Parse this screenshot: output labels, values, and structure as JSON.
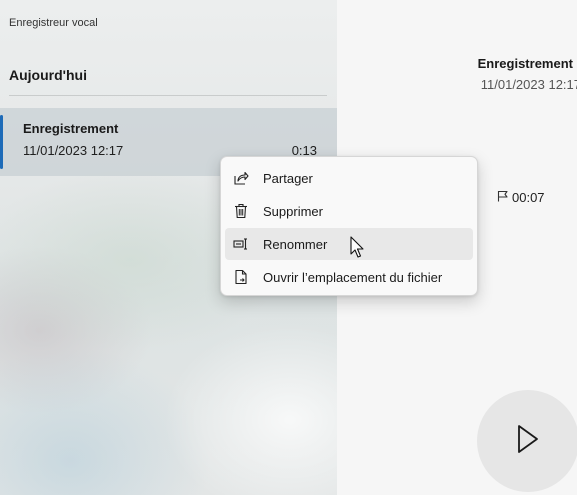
{
  "app": {
    "title": "Enregistreur vocal"
  },
  "list": {
    "section_header": "Aujourd'hui",
    "items": [
      {
        "name": "Enregistrement",
        "date": "11/01/2023 12:17",
        "duration": "0:13",
        "selected": true
      }
    ]
  },
  "detail": {
    "title": "Enregistrement",
    "date": "11/01/2023 12:17",
    "marker_time": "00:07",
    "marker_icon": "flag-icon",
    "play_icon": "play-icon"
  },
  "context_menu": {
    "items": [
      {
        "label": "Partager",
        "icon": "share-icon"
      },
      {
        "label": "Supprimer",
        "icon": "trash-icon"
      },
      {
        "label": "Renommer",
        "icon": "rename-icon",
        "hovered": true
      },
      {
        "label": "Ouvrir l’emplacement du fichier",
        "icon": "open-file-location-icon"
      }
    ]
  },
  "colors": {
    "accent": "#1d6bb8",
    "menu_background": "#f9f9f9",
    "menu_hover": "#e8e8e8"
  }
}
